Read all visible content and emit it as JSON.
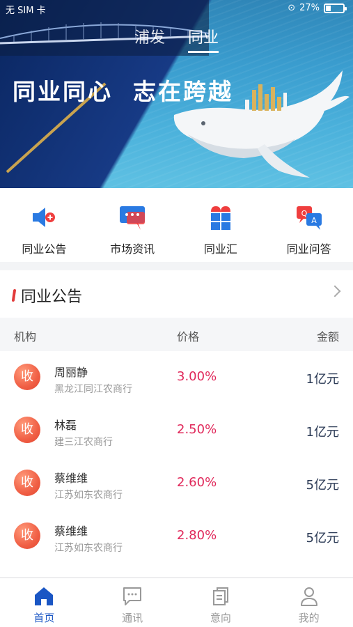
{
  "statusbar": {
    "carrier": "无 SIM 卡",
    "battery": "27%"
  },
  "hero": {
    "tabs": [
      {
        "label": "浦发"
      },
      {
        "label": "同业"
      }
    ],
    "slogan": "同业同心  志在跨越"
  },
  "quick_menu": [
    {
      "label": "同业公告",
      "icon": "megaphone-icon"
    },
    {
      "label": "市场资讯",
      "icon": "chat-bubble-icon"
    },
    {
      "label": "同业汇",
      "icon": "building-icon"
    },
    {
      "label": "同业问答",
      "icon": "qa-icon"
    }
  ],
  "announcements": {
    "title": "同业公告",
    "columns": {
      "org": "机构",
      "price": "价格",
      "amount": "金额"
    },
    "rows": [
      {
        "badge": "收",
        "name": "周丽静",
        "bank": "黑龙江同江农商行",
        "price": "3.00%",
        "amount": "1亿元"
      },
      {
        "badge": "收",
        "name": "林磊",
        "bank": "建三江农商行",
        "price": "2.50%",
        "amount": "1亿元"
      },
      {
        "badge": "收",
        "name": "蔡维维",
        "bank": "江苏如东农商行",
        "price": "2.60%",
        "amount": "5亿元"
      },
      {
        "badge": "收",
        "name": "蔡维维",
        "bank": "江苏如东农商行",
        "price": "2.80%",
        "amount": "5亿元"
      }
    ]
  },
  "bottom_nav": [
    {
      "label": "首页",
      "icon": "home-icon",
      "active": true
    },
    {
      "label": "通讯",
      "icon": "message-icon"
    },
    {
      "label": "意向",
      "icon": "document-icon"
    },
    {
      "label": "我的",
      "icon": "user-icon"
    }
  ],
  "colors": {
    "accent": "#1a56c4",
    "price": "#e0285a",
    "badge": "#f05f45"
  }
}
